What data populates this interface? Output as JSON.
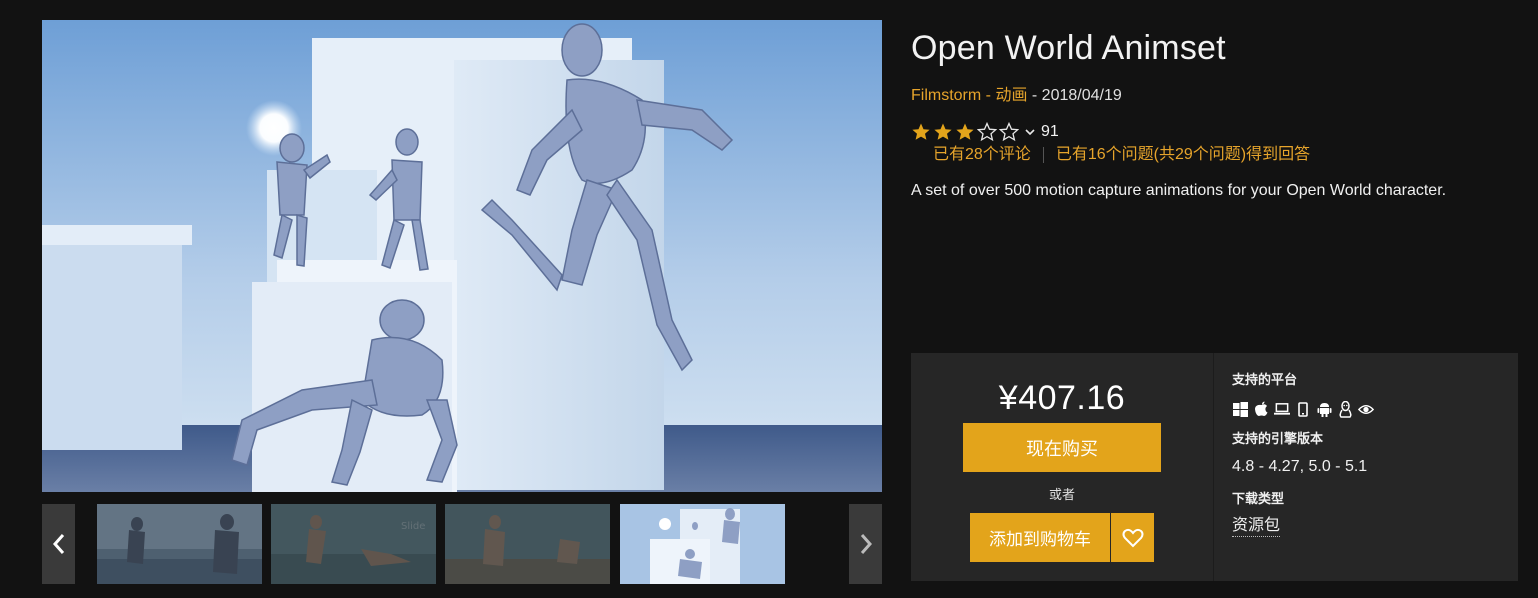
{
  "product": {
    "title": "Open World Animset",
    "seller": "Filmstorm",
    "meta_sep1": " - ",
    "category": "动画",
    "meta_sep2": " - ",
    "date": "2018/04/19",
    "rating": 3,
    "rating_max": 5,
    "rating_count": "91",
    "reviews_link": "已有28个评论",
    "questions_link": "已有16个问题(共29个问题)得到回答",
    "description": "A set of over 500 motion capture animations for your Open World character."
  },
  "purchase": {
    "price": "¥407.16",
    "buy_label": "现在购买",
    "or_label": "或者",
    "cart_label": "添加到购物车"
  },
  "specs": {
    "platforms_heading": "支持的平台",
    "platform_icons": [
      "windows-icon",
      "apple-icon",
      "laptop-icon",
      "mobile-icon",
      "android-icon",
      "linux-icon",
      "vr-eye-icon"
    ],
    "engine_heading": "支持的引擎版本",
    "engine_versions": "4.8 - 4.27, 5.0 - 5.1",
    "download_heading": "下载类型",
    "download_type": "资源包"
  },
  "gallery": {
    "active_index": 3,
    "thumbnail_count": 4
  },
  "colors": {
    "accent": "#e3a41b",
    "link": "#e6a42b",
    "background": "#121212",
    "panel": "#262626"
  }
}
